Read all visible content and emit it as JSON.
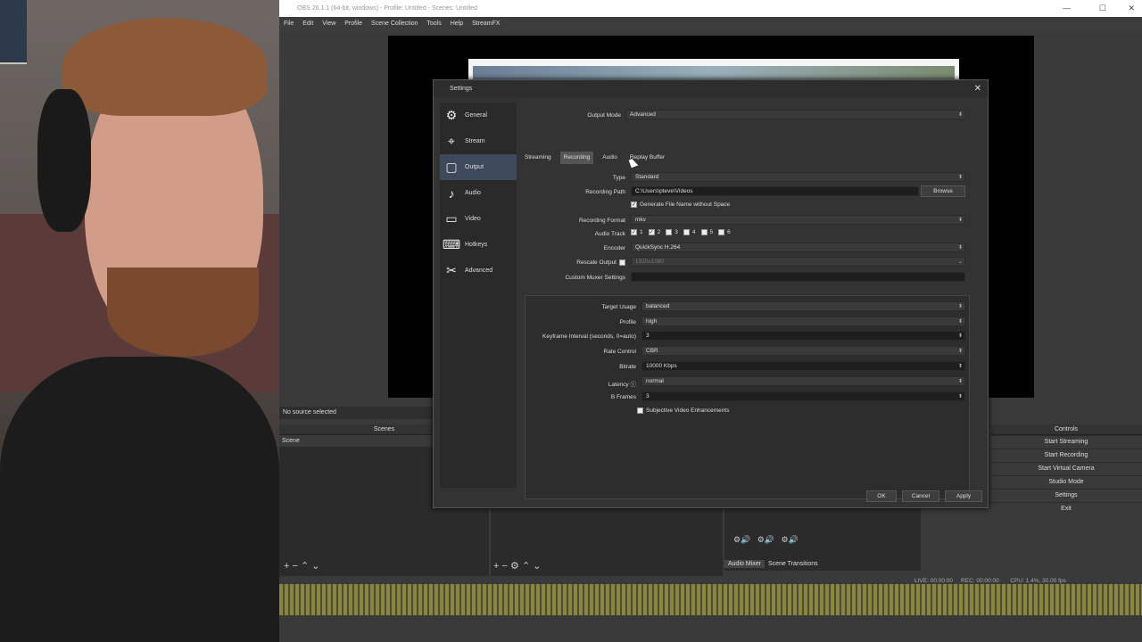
{
  "window": {
    "title": "OBS 26.1.1 (64-bit, windows) - Profile: Untitled - Scenes: Untitled"
  },
  "menu": [
    "File",
    "Edit",
    "View",
    "Profile",
    "Scene Collection",
    "Tools",
    "Help",
    "StreamFX"
  ],
  "main": {
    "no_source": "No source selected",
    "scenes_header": "Scenes",
    "scene_item": "Scene",
    "controls_header": "Controls",
    "controls": [
      "Start Streaming",
      "Start Recording",
      "Start Virtual Camera",
      "Studio Mode",
      "Settings",
      "Exit"
    ],
    "mixer_tabs": [
      "Audio Mixer",
      "Scene Transitions"
    ],
    "status": {
      "live": "LIVE: 00:00:00",
      "rec": "REC: 00:00:00",
      "cpu": "CPU: 1.4%, 30.00 fps"
    }
  },
  "settings": {
    "title": "Settings",
    "nav": [
      {
        "label": "General",
        "icon": "gear-icon",
        "glyph": "⚙"
      },
      {
        "label": "Stream",
        "icon": "antenna-icon",
        "glyph": "📡"
      },
      {
        "label": "Output",
        "icon": "monitor-output-icon",
        "glyph": "🖵"
      },
      {
        "label": "Audio",
        "icon": "speaker-icon",
        "glyph": "🔊"
      },
      {
        "label": "Video",
        "icon": "display-icon",
        "glyph": "▭"
      },
      {
        "label": "Hotkeys",
        "icon": "keyboard-icon",
        "glyph": "⌨"
      },
      {
        "label": "Advanced",
        "icon": "tools-icon",
        "glyph": "✂"
      }
    ],
    "output_mode_label": "Output Mode",
    "output_mode_value": "Advanced",
    "tabs": [
      "Streaming",
      "Recording",
      "Audio",
      "Replay Buffer"
    ],
    "recording": {
      "type_label": "Type",
      "type_value": "Standard",
      "path_label": "Recording Path",
      "path_value": "C:\\Users\\pteve\\Videos",
      "browse": "Browse",
      "gen_name": "Generate File Name without Space",
      "format_label": "Recording Format",
      "format_value": "mkv",
      "track_label": "Audio Track",
      "tracks": [
        "1",
        "2",
        "3",
        "4",
        "5",
        "6"
      ],
      "encoder_label": "Encoder",
      "encoder_value": "QuickSync H.264",
      "rescale_label": "Rescale Output",
      "rescale_value": "1920x1080",
      "muxer_label": "Custom Muxer Settings"
    },
    "encoder": {
      "target_usage_label": "Target Usage",
      "target_usage": "balanced",
      "profile_label": "Profile",
      "profile": "high",
      "keyframe_label": "Keyframe Interval (seconds, 0=auto)",
      "keyframe": "3",
      "rate_control_label": "Rate Control",
      "rate_control": "CBR",
      "bitrate_label": "Bitrate",
      "bitrate": "10000 Kbps",
      "latency_label": "Latency",
      "latency": "normal",
      "bframes_label": "B Frames",
      "bframes": "3",
      "subjective": "Subjective Video Enhancements"
    },
    "buttons": {
      "ok": "OK",
      "cancel": "Cancel",
      "apply": "Apply"
    }
  }
}
